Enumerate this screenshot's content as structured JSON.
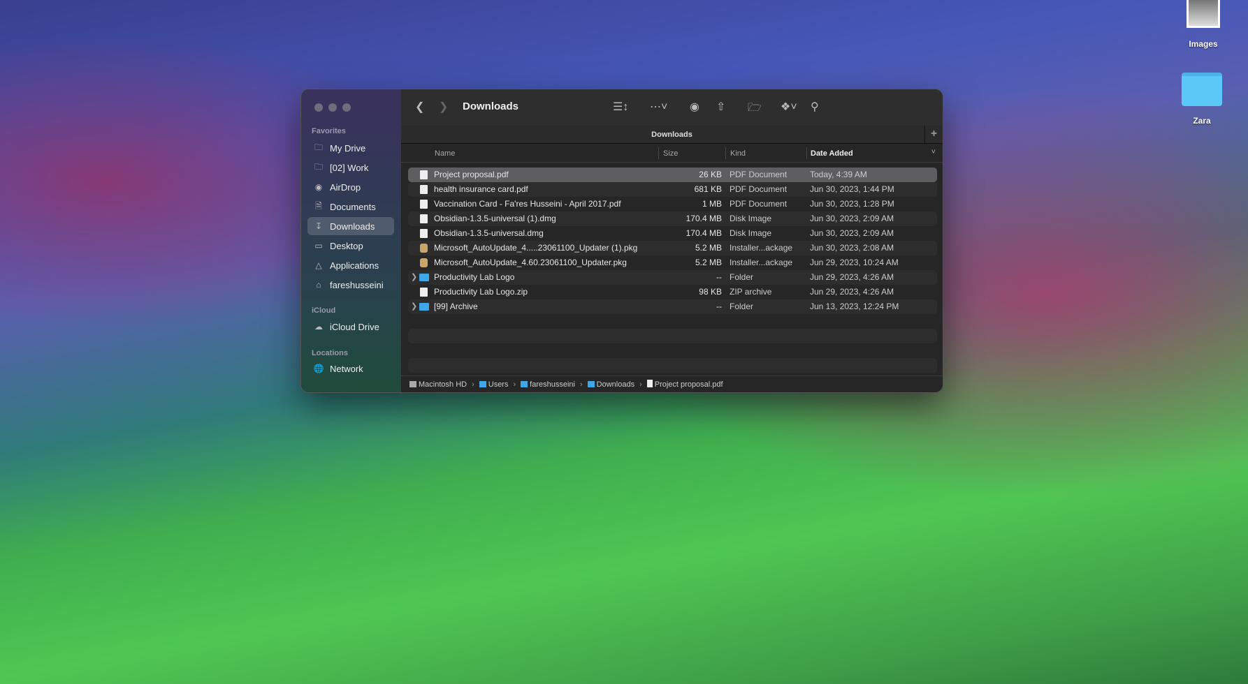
{
  "desktop": [
    {
      "label": "Images",
      "icon": "photo-stack-icon"
    },
    {
      "label": "Zara",
      "icon": "folder-icon"
    }
  ],
  "window": {
    "title": "Downloads",
    "tab": "Downloads"
  },
  "sidebar": {
    "favorites_label": "Favorites",
    "favorites": [
      {
        "label": "My Drive",
        "icon": "folder-icon"
      },
      {
        "label": "[02] Work",
        "icon": "folder-icon"
      },
      {
        "label": "AirDrop",
        "icon": "airdrop-icon"
      },
      {
        "label": "Documents",
        "icon": "document-icon"
      },
      {
        "label": "Downloads",
        "icon": "download-icon",
        "selected": true
      },
      {
        "label": "Desktop",
        "icon": "desktop-icon"
      },
      {
        "label": "Applications",
        "icon": "applications-icon"
      },
      {
        "label": "fareshusseini",
        "icon": "home-icon"
      }
    ],
    "icloud_label": "iCloud",
    "icloud": [
      {
        "label": "iCloud Drive",
        "icon": "cloud-icon"
      }
    ],
    "locations_label": "Locations",
    "locations": [
      {
        "label": "Network",
        "icon": "globe-icon"
      }
    ]
  },
  "columns": {
    "name": "Name",
    "size": "Size",
    "kind": "Kind",
    "date": "Date Added"
  },
  "files": [
    {
      "name": "Project proposal.pdf",
      "size": "26 KB",
      "kind": "PDF Document",
      "date": "Today, 4:39 AM",
      "type": "doc",
      "selected": true
    },
    {
      "name": "health insurance card.pdf",
      "size": "681 KB",
      "kind": "PDF Document",
      "date": "Jun 30, 2023, 1:44 PM",
      "type": "doc"
    },
    {
      "name": "Vaccination Card - Fa'res Husseini - April 2017.pdf",
      "size": "1 MB",
      "kind": "PDF Document",
      "date": "Jun 30, 2023, 1:28 PM",
      "type": "doc"
    },
    {
      "name": "Obsidian-1.3.5-universal (1).dmg",
      "size": "170.4 MB",
      "kind": "Disk Image",
      "date": "Jun 30, 2023, 2:09 AM",
      "type": "doc"
    },
    {
      "name": "Obsidian-1.3.5-universal.dmg",
      "size": "170.4 MB",
      "kind": "Disk Image",
      "date": "Jun 30, 2023, 2:09 AM",
      "type": "doc"
    },
    {
      "name": "Microsoft_AutoUpdate_4.....23061100_Updater (1).pkg",
      "size": "5.2 MB",
      "kind": "Installer...ackage",
      "date": "Jun 30, 2023, 2:08 AM",
      "type": "pkg"
    },
    {
      "name": "Microsoft_AutoUpdate_4.60.23061100_Updater.pkg",
      "size": "5.2 MB",
      "kind": "Installer...ackage",
      "date": "Jun 29, 2023, 10:24 AM",
      "type": "pkg"
    },
    {
      "name": "Productivity Lab Logo",
      "size": "--",
      "kind": "Folder",
      "date": "Jun 29, 2023, 4:26 AM",
      "type": "folder"
    },
    {
      "name": "Productivity Lab Logo.zip",
      "size": "98 KB",
      "kind": "ZIP archive",
      "date": "Jun 29, 2023, 4:26 AM",
      "type": "doc"
    },
    {
      "name": "[99] Archive",
      "size": "--",
      "kind": "Folder",
      "date": "Jun 13, 2023, 12:24 PM",
      "type": "folder"
    }
  ],
  "path": [
    "Macintosh HD",
    "Users",
    "fareshusseini",
    "Downloads",
    "Project proposal.pdf"
  ]
}
